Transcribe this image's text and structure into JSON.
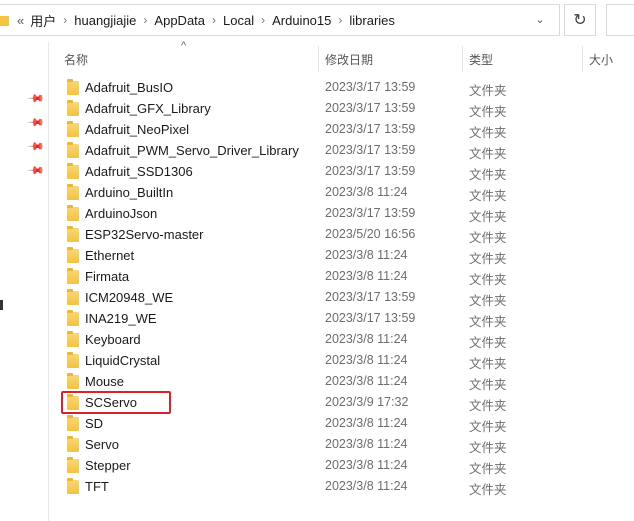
{
  "address_bar": {
    "back_glyph": "«",
    "crumbs": [
      "用户",
      "huangjiajie",
      "AppData",
      "Local",
      "Arduino15",
      "libraries"
    ],
    "separator": "›",
    "dropdown_glyph": "⌄",
    "refresh_glyph": "↻"
  },
  "columns": {
    "name": "名称",
    "date": "修改日期",
    "type": "类型",
    "size": "大小",
    "sort_arrow": "^"
  },
  "files": [
    {
      "name": "Adafruit_BusIO",
      "date": "2023/3/17 13:59",
      "type": "文件夹"
    },
    {
      "name": "Adafruit_GFX_Library",
      "date": "2023/3/17 13:59",
      "type": "文件夹"
    },
    {
      "name": "Adafruit_NeoPixel",
      "date": "2023/3/17 13:59",
      "type": "文件夹"
    },
    {
      "name": "Adafruit_PWM_Servo_Driver_Library",
      "date": "2023/3/17 13:59",
      "type": "文件夹"
    },
    {
      "name": "Adafruit_SSD1306",
      "date": "2023/3/17 13:59",
      "type": "文件夹"
    },
    {
      "name": "Arduino_BuiltIn",
      "date": "2023/3/8 11:24",
      "type": "文件夹"
    },
    {
      "name": "ArduinoJson",
      "date": "2023/3/17 13:59",
      "type": "文件夹"
    },
    {
      "name": "ESP32Servo-master",
      "date": "2023/5/20 16:56",
      "type": "文件夹"
    },
    {
      "name": "Ethernet",
      "date": "2023/3/8 11:24",
      "type": "文件夹"
    },
    {
      "name": "Firmata",
      "date": "2023/3/8 11:24",
      "type": "文件夹"
    },
    {
      "name": "ICM20948_WE",
      "date": "2023/3/17 13:59",
      "type": "文件夹"
    },
    {
      "name": "INA219_WE",
      "date": "2023/3/17 13:59",
      "type": "文件夹"
    },
    {
      "name": "Keyboard",
      "date": "2023/3/8 11:24",
      "type": "文件夹"
    },
    {
      "name": "LiquidCrystal",
      "date": "2023/3/8 11:24",
      "type": "文件夹"
    },
    {
      "name": "Mouse",
      "date": "2023/3/8 11:24",
      "type": "文件夹"
    },
    {
      "name": "SCServo",
      "date": "2023/3/9 17:32",
      "type": "文件夹"
    },
    {
      "name": "SD",
      "date": "2023/3/8 11:24",
      "type": "文件夹"
    },
    {
      "name": "Servo",
      "date": "2023/3/8 11:24",
      "type": "文件夹"
    },
    {
      "name": "Stepper",
      "date": "2023/3/8 11:24",
      "type": "文件夹"
    },
    {
      "name": "TFT",
      "date": "2023/3/8 11:24",
      "type": "文件夹"
    }
  ],
  "highlighted_item": "SCServo",
  "colors": {
    "highlight": "#d7232a",
    "folder": "#f3c243"
  },
  "icons": {
    "folder": "folder-icon",
    "pin": "pin-icon",
    "refresh": "refresh-icon"
  }
}
